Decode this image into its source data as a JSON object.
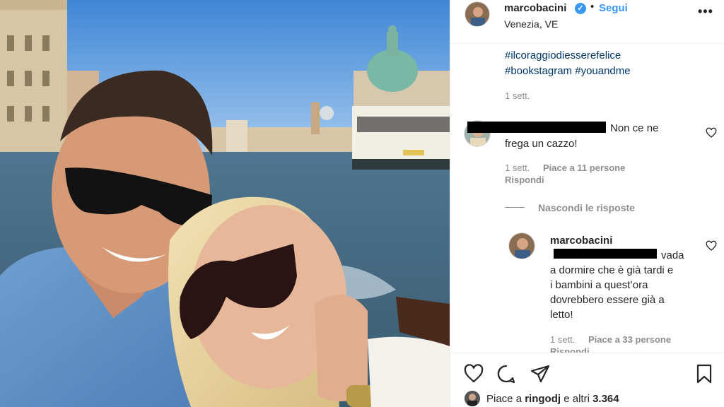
{
  "header": {
    "username": "marcobacini",
    "verified_icon": "verified-badge-icon",
    "separator": "•",
    "follow_label": "Segui",
    "location": "Venezia, VE",
    "more_label": "•••"
  },
  "caption": {
    "hashtags_line1": "#ilcoraggiodiesserefelice",
    "hashtags_line2": "#bookstagram #youandme",
    "time": "1 sett."
  },
  "comment": {
    "text_line1": "Non ce ne",
    "text_line2": "frega un cazzo!",
    "time": "1 sett.",
    "likes": "Piace a 11 persone",
    "reply_label": "Rispondi"
  },
  "hide_replies_label": "Nascondi le risposte",
  "reply": {
    "username": "marcobacini",
    "text_line1": "vada",
    "text_line2": "a dormire che è già tardi e",
    "text_line3": "i bambini a quest’ora",
    "text_line4": "dovrebbero essere già a",
    "text_line5": "letto!",
    "time": "1 sett.",
    "likes": "Piace a 33 persone",
    "reply_label": "Rispondi"
  },
  "likes_bar": {
    "prefix": "Piace a",
    "user": "ringodj",
    "conjunction": "e altri",
    "count": "3.364"
  },
  "colors": {
    "link_blue": "#3897f0",
    "hashtag": "#00376b",
    "muted": "#8e8e8e"
  }
}
